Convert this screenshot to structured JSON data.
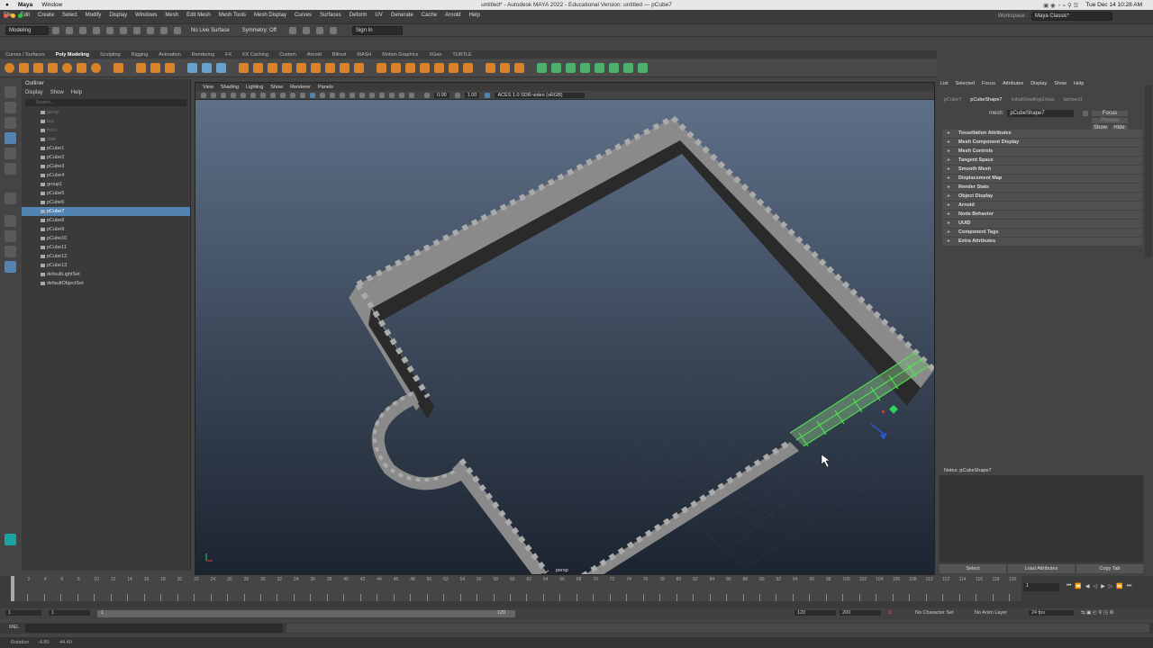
{
  "mac": {
    "app": "Maya",
    "menu": [
      "Window"
    ],
    "title": "untitled* - Autodesk MAYA 2022 - Educational Version: untitled  ---  pCube7",
    "clock": "Tue Dec 14  10:28 AM"
  },
  "menubar": [
    "File",
    "Edit",
    "Create",
    "Select",
    "Modify",
    "Display",
    "Windows",
    "Mesh",
    "Edit Mesh",
    "Mesh Tools",
    "Mesh Display",
    "Curves",
    "Surfaces",
    "Deform",
    "UV",
    "Generate",
    "Cache",
    "Arnold",
    "Help"
  ],
  "workspace": {
    "label": "Workspace :",
    "value": "Maya Classic*"
  },
  "status": {
    "mode": "Modeling",
    "live": "No Live Surface",
    "symmetry": "Symmetry: Off",
    "signin": "Sign In"
  },
  "shelf_tabs": [
    "Curves / Surfaces",
    "Poly Modeling",
    "Sculpting",
    "Rigging",
    "Animation",
    "Rendering",
    "FX",
    "FX Caching",
    "Custom",
    "Arnold",
    "Bifrost",
    "MASH",
    "Motion Graphics",
    "XGen",
    "TURTLE"
  ],
  "shelf_active": "Poly Modeling",
  "outliner": {
    "title": "Outliner",
    "menu": [
      "Display",
      "Show",
      "Help"
    ],
    "search": "Search...",
    "items": [
      {
        "name": "persp",
        "dim": true
      },
      {
        "name": "top",
        "dim": true
      },
      {
        "name": "front",
        "dim": true
      },
      {
        "name": "side",
        "dim": true
      },
      {
        "name": "pCube1"
      },
      {
        "name": "pCube2"
      },
      {
        "name": "pCube3"
      },
      {
        "name": "pCube4"
      },
      {
        "name": "group1"
      },
      {
        "name": "pCube5"
      },
      {
        "name": "pCube6"
      },
      {
        "name": "pCube7",
        "selected": true
      },
      {
        "name": "pCube8"
      },
      {
        "name": "pCube9"
      },
      {
        "name": "pCube10"
      },
      {
        "name": "pCube11"
      },
      {
        "name": "pCube12"
      },
      {
        "name": "pCube13"
      },
      {
        "name": "defaultLightSet"
      },
      {
        "name": "defaultObjectSet"
      }
    ]
  },
  "viewport": {
    "menu": [
      "View",
      "Shading",
      "Lighting",
      "Show",
      "Renderer",
      "Panels"
    ],
    "val1": "0.00",
    "val2": "1.00",
    "colorspace": "ACES 1.0 SDR-video (sRGB)",
    "camera": "persp"
  },
  "attr": {
    "menu": [
      "List",
      "Selected",
      "Focus",
      "Attributes",
      "Display",
      "Show",
      "Help"
    ],
    "tabs": [
      "pCube7",
      "pCubeShape7",
      "initialShadingGroup",
      "lambert1"
    ],
    "mesh_label": "mesh:",
    "mesh_value": "pCubeShape7",
    "focus": "Focus",
    "presets": "Presets",
    "show": "Show",
    "hide": "Hide",
    "sections": [
      "Tessellation Attributes",
      "Mesh Component Display",
      "Mesh Controls",
      "Tangent Space",
      "Smooth Mesh",
      "Displacement Map",
      "Render Stats",
      "Object Display",
      "Arnold",
      "Node Behavior",
      "UUID",
      "Component Tags",
      "Extra Attributes"
    ],
    "notes": "Notes:  pCubeShape7",
    "buttons": [
      "Select",
      "Load Attributes",
      "Copy Tab"
    ]
  },
  "timeline": {
    "ticks": [
      "2",
      "4",
      "6",
      "8",
      "10",
      "12",
      "14",
      "16",
      "18",
      "20",
      "22",
      "24",
      "26",
      "28",
      "30",
      "32",
      "34",
      "36",
      "38",
      "40",
      "42",
      "44",
      "46",
      "48",
      "50",
      "52",
      "54",
      "56",
      "58",
      "60",
      "62",
      "64",
      "66",
      "68",
      "70",
      "72",
      "74",
      "76",
      "78",
      "80",
      "82",
      "84",
      "86",
      "88",
      "90",
      "92",
      "94",
      "96",
      "98",
      "100",
      "102",
      "104",
      "106",
      "108",
      "110",
      "112",
      "114",
      "116",
      "118",
      "120"
    ],
    "current": "1"
  },
  "range": {
    "start": "1",
    "start2": "1",
    "handle": "1",
    "end_handle": "120",
    "end": "120",
    "end2": "200",
    "charset": "No Character Set",
    "animlayer": "No Anim Layer",
    "fps": "24 fps"
  },
  "cmd": {
    "label": "MEL"
  },
  "help": {
    "label": "Rotation",
    "x": "-4.80",
    "y": "44.40"
  }
}
